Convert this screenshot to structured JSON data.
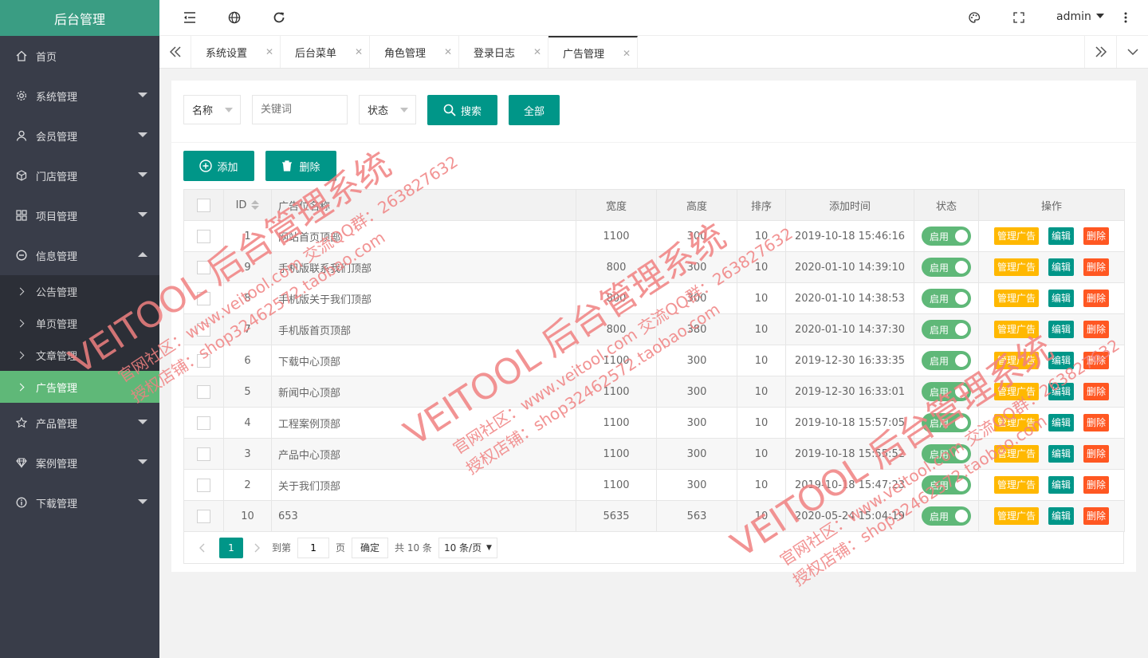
{
  "app": {
    "title": "后台管理"
  },
  "sidebar": {
    "items": [
      {
        "label": "首页",
        "icon": "home-icon",
        "caret": ""
      },
      {
        "label": "系统管理",
        "icon": "gear-icon",
        "caret": "down"
      },
      {
        "label": "会员管理",
        "icon": "user-icon",
        "caret": "down"
      },
      {
        "label": "门店管理",
        "icon": "box-icon",
        "caret": "down"
      },
      {
        "label": "项目管理",
        "icon": "grid-icon",
        "caret": "down"
      },
      {
        "label": "信息管理",
        "icon": "info-circle-icon",
        "caret": "up"
      }
    ],
    "submenu": [
      {
        "label": "公告管理"
      },
      {
        "label": "单页管理"
      },
      {
        "label": "文章管理"
      },
      {
        "label": "广告管理",
        "active": true
      }
    ],
    "items_after": [
      {
        "label": "产品管理",
        "icon": "star-icon"
      },
      {
        "label": "案例管理",
        "icon": "diamond-icon"
      },
      {
        "label": "下载管理",
        "icon": "info-icon"
      }
    ]
  },
  "header": {
    "user": "admin"
  },
  "tabs": [
    {
      "label": "系统设置"
    },
    {
      "label": "后台菜单"
    },
    {
      "label": "角色管理"
    },
    {
      "label": "登录日志"
    },
    {
      "label": "广告管理",
      "active": true
    }
  ],
  "search": {
    "field_select": "名称",
    "keyword_placeholder": "关键词",
    "status_select": "状态",
    "search_label": "搜索",
    "all_label": "全部"
  },
  "toolbar": {
    "add_label": "添加",
    "delete_label": "删除"
  },
  "table": {
    "columns": [
      "ID",
      "广告位名称",
      "宽度",
      "高度",
      "排序",
      "添加时间",
      "状态",
      "操作"
    ],
    "rows": [
      {
        "id": "1",
        "name": "网站首页顶部",
        "width": "1100",
        "height": "300",
        "sort": "10",
        "time": "2019-10-18 15:46:16"
      },
      {
        "id": "9",
        "name": "手机版联系我们顶部",
        "width": "800",
        "height": "300",
        "sort": "10",
        "time": "2020-01-10 14:39:10"
      },
      {
        "id": "8",
        "name": "手机版关于我们顶部",
        "width": "800",
        "height": "300",
        "sort": "10",
        "time": "2020-01-10 14:38:53"
      },
      {
        "id": "7",
        "name": "手机版首页顶部",
        "width": "800",
        "height": "380",
        "sort": "10",
        "time": "2020-01-10 14:37:30"
      },
      {
        "id": "6",
        "name": "下载中心顶部",
        "width": "1100",
        "height": "300",
        "sort": "10",
        "time": "2019-12-30 16:33:35"
      },
      {
        "id": "5",
        "name": "新闻中心顶部",
        "width": "1100",
        "height": "300",
        "sort": "10",
        "time": "2019-12-30 16:33:01"
      },
      {
        "id": "4",
        "name": "工程案例顶部",
        "width": "1100",
        "height": "300",
        "sort": "10",
        "time": "2019-10-18 15:57:05"
      },
      {
        "id": "3",
        "name": "产品中心顶部",
        "width": "1100",
        "height": "300",
        "sort": "10",
        "time": "2019-10-18 15:55:52"
      },
      {
        "id": "2",
        "name": "关于我们顶部",
        "width": "1100",
        "height": "300",
        "sort": "10",
        "time": "2019-10-18 15:47:23"
      },
      {
        "id": "10",
        "name": "653",
        "width": "5635",
        "height": "563",
        "sort": "10",
        "time": "2020-05-24 15:04:19"
      }
    ],
    "status_label": "启用",
    "action_manage": "管理广告",
    "action_edit": "编辑",
    "action_delete": "删除"
  },
  "pagination": {
    "current": "1",
    "goto_prefix": "到第",
    "goto_value": "1",
    "goto_suffix": "页",
    "confirm": "确定",
    "total": "共 10 条",
    "page_size": "10 条/页"
  },
  "watermark": {
    "lines": [
      "VEITOOL 后台管理系统",
      "官网社区：www.veitool.com  交流QQ群：263827632",
      "授权店铺：shop32462572.taobao.com"
    ]
  },
  "colors": {
    "primary": "#009688",
    "sidebar": "#393d49",
    "logo": "#3a9d83",
    "active": "#5fb878",
    "warn": "#ffb800",
    "danger": "#ff5722",
    "watermark": "#f08080"
  }
}
